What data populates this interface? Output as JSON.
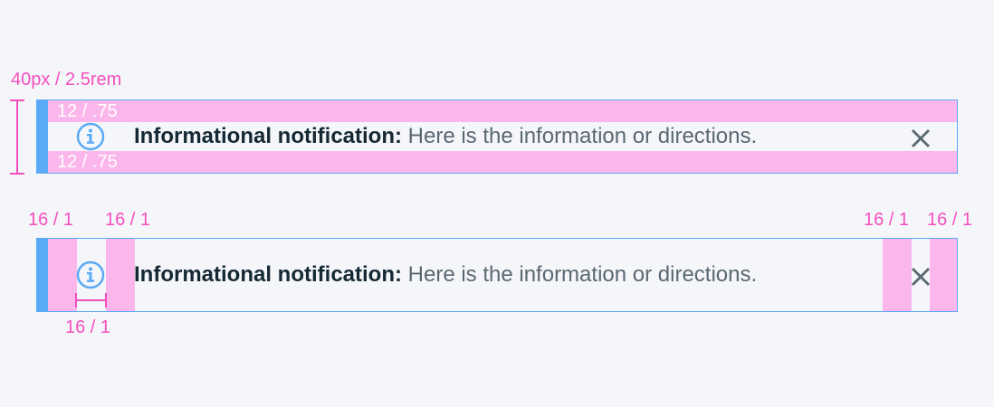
{
  "spec": {
    "height_label": "40px / 2.5rem",
    "top_padding_label": "12 / .75",
    "bottom_padding_label": "12 / .75",
    "left_padding_label": "16 / 1",
    "icon_gap_label": "16 / 1",
    "icon_spacing_label": "16 / 1",
    "close_left_label": "16 / 1",
    "close_right_label": "16 / 1"
  },
  "notification": {
    "title": "Informational notification:",
    "message": " Here is the information or directions."
  },
  "colors": {
    "accent": "#5aaaf6",
    "spacing_overlay": "#fbb6eb",
    "annotation": "#f44fbd",
    "title": "#152935",
    "message": "#5a6872",
    "close": "#5a6872",
    "background": "#f5f6fa"
  },
  "icons": {
    "status": "info-circle-icon",
    "close": "close-icon"
  }
}
